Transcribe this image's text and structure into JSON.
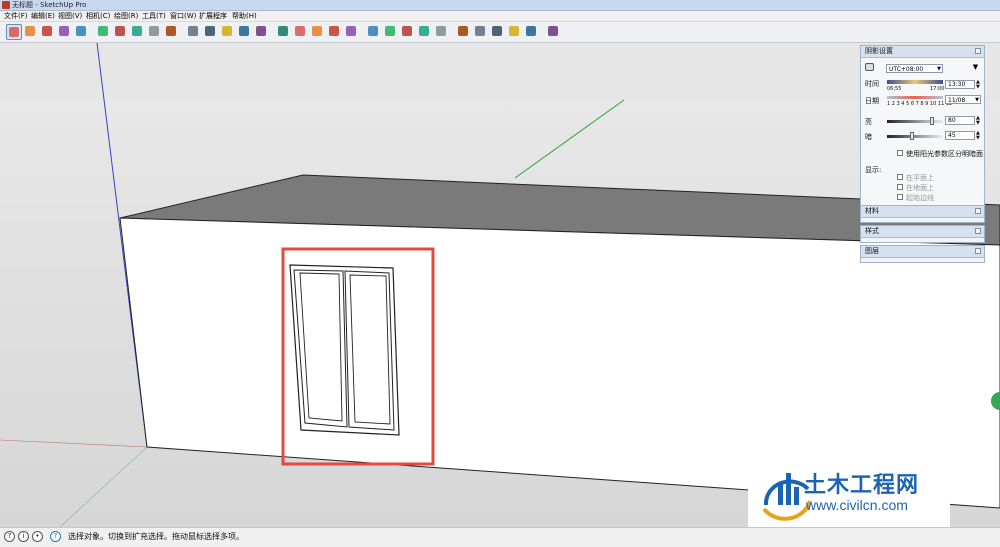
{
  "window": {
    "title": "无标题 - SketchUp Pro"
  },
  "menu": [
    "文件(F)",
    "编辑(E)",
    "视图(V)",
    "相机(C)",
    "绘图(R)",
    "工具(T)",
    "窗口(W)",
    "扩展程序",
    "帮助(H)"
  ],
  "toolbar": {
    "tools": [
      "select-tool",
      "eraser-tool",
      "line-tool",
      "arc-tool",
      "shape-tool",
      "push-pull-tool",
      "move-tool",
      "rotate-tool",
      "scale-tool",
      "offset-tool",
      "tape-measure-tool",
      "text-tool",
      "paint-bucket-tool",
      "orbit-tool",
      "pan-tool",
      "zoom-tool",
      "zoom-extents-tool",
      "warehouse-tool",
      "extension-tool",
      "component-tool",
      "view-iso",
      "view-top",
      "view-front",
      "view-right",
      "view-back",
      "view-left",
      "section-plane-tool",
      "sandbox-tool",
      "styles-tool",
      "shadows-toggle",
      "fog-toggle"
    ],
    "active_tool": "select-tool"
  },
  "panels": {
    "shadow": {
      "title": "阴影设置",
      "timezone": "UTC+08:00",
      "time_label": "时间",
      "time_start": "06:55",
      "time_end": "17:00",
      "time_value": "13:30",
      "date_label": "日期",
      "months": "1 2 3 4 5 6 7 8 9 10 11 12",
      "date_value": "11/08",
      "light_label": "亮",
      "light_value": "80",
      "light_level": 0.8,
      "dark_label": "暗",
      "dark_value": "45",
      "dark_level": 0.45,
      "sun_shading_label": "使用阳光参数区分明暗面",
      "display_label": "显示:",
      "display_options": [
        "在平面上",
        "在地面上",
        "起始边线"
      ]
    },
    "materials": {
      "title": "材料"
    },
    "styles": {
      "title": "样式"
    },
    "layers": {
      "title": "图层"
    }
  },
  "status": {
    "text": "选择对象。切换到扩充选择。拖动鼠标选择多项。"
  },
  "watermark": {
    "name": "土木工程网",
    "url": "www.civilcn.com"
  },
  "colors": {
    "accent_red": "#e04a3f",
    "logo_blue": "#1d63b5",
    "axis_green": "#2e9e3a",
    "axis_blue": "#3344cc"
  }
}
